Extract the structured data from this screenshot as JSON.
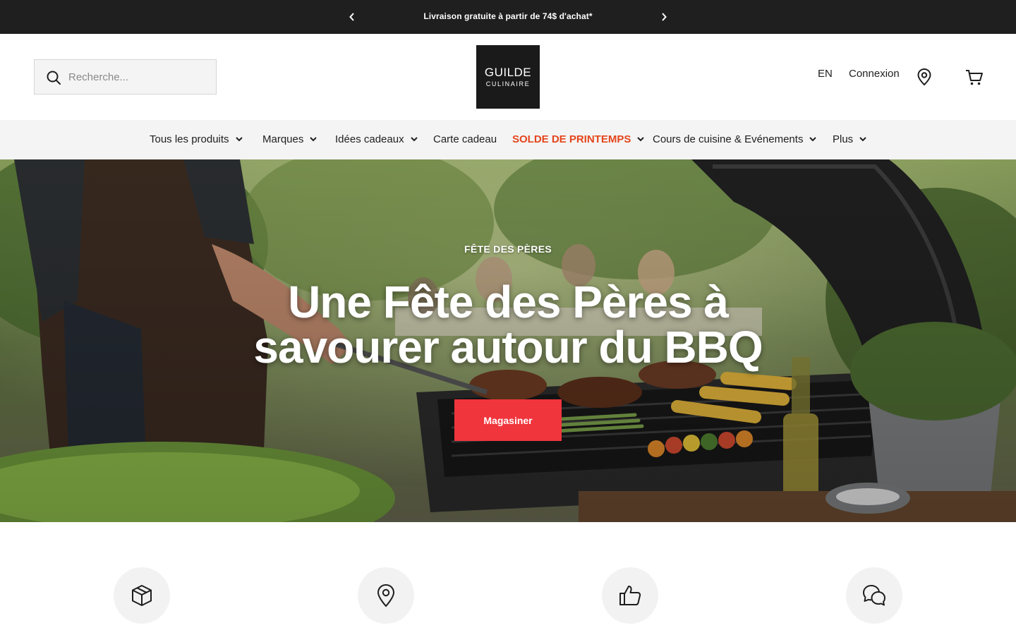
{
  "announcement": {
    "message": "Livraison gratuite à partir de 74$ d'achat*",
    "prev_icon": "chevron-left-icon",
    "next_icon": "chevron-right-icon"
  },
  "header": {
    "search": {
      "placeholder": "Recherche...",
      "value": "",
      "icon": "search-icon"
    },
    "logo": {
      "line1": "GUILDE",
      "line2": "CULINAIRE"
    },
    "language": "EN",
    "login": "Connexion",
    "location_icon": "map-pin-icon",
    "cart_icon": "cart-icon"
  },
  "nav": {
    "items": [
      {
        "label": "Tous les produits",
        "dropdown": true
      },
      {
        "label": "Marques",
        "dropdown": true
      },
      {
        "label": "Idées cadeaux",
        "dropdown": true
      },
      {
        "label": "Carte cadeau",
        "dropdown": false
      },
      {
        "label": "SOLDE DE PRINTEMPS",
        "dropdown": true,
        "highlight": true
      },
      {
        "label": "Cours de cuisine & Evénements",
        "dropdown": true
      },
      {
        "label": "Plus",
        "dropdown": true
      }
    ]
  },
  "hero": {
    "eyebrow": "FÊTE DES PÈRES",
    "title": "Une Fête des Pères à savourer autour du BBQ",
    "cta": "Magasiner"
  },
  "features": [
    {
      "icon": "box-icon"
    },
    {
      "icon": "map-pin-icon"
    },
    {
      "icon": "thumbs-up-icon"
    },
    {
      "icon": "chat-bubbles-icon"
    }
  ],
  "colors": {
    "topbar": "#1f1f1f",
    "nav_bg": "#f4f4f4",
    "sale": "#e4451b",
    "cta": "#f0353d"
  }
}
